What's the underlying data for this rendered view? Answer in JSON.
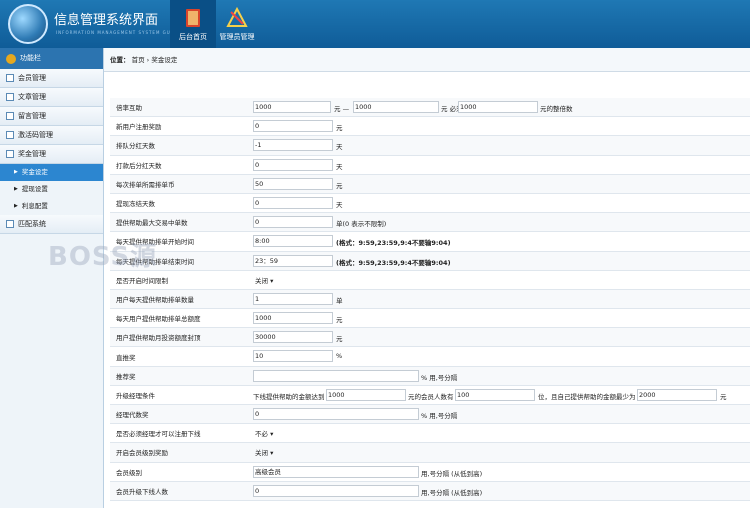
{
  "header": {
    "title": "信息管理系统界面",
    "subtitle": "INFORMATION MANAGEMENT SYSTEM GUI",
    "nav": [
      {
        "label": "后台首页",
        "icon": "book-icon"
      },
      {
        "label": "管理员管理",
        "icon": "tools-icon"
      }
    ]
  },
  "sidebar": {
    "head": "功能栏",
    "items": [
      "会员管理",
      "文章管理",
      "留言管理",
      "激活码管理",
      "奖金管理"
    ],
    "subitems": [
      "奖金设定",
      "提现设置",
      "利息配置"
    ],
    "last": "匹配系统"
  },
  "breadcrumb": {
    "label": "位置：",
    "home": "首页",
    "sep": "›",
    "current": "奖金设定"
  },
  "form": {
    "r1": {
      "label": "倍率互助",
      "v1": "1000",
      "t1": "元 —",
      "v2": "1000",
      "t2": "元 必须",
      "v3": "1000",
      "t3": "元的整倍数"
    },
    "r2": {
      "label": "新用户注册奖励",
      "v": "0",
      "t": "元"
    },
    "r3": {
      "label": "排队分红天数",
      "v": "-1",
      "t": "天"
    },
    "r4": {
      "label": "打款后分红天数",
      "v": "0",
      "t": "天"
    },
    "r5": {
      "label": "每次排单所需排单币",
      "v": "50",
      "t": "元"
    },
    "r6": {
      "label": "提现冻结天数",
      "v": "0",
      "t": "天"
    },
    "r7": {
      "label": "提供帮助最大交易中单数",
      "v": "0",
      "t": "单(0 表示不限制)"
    },
    "r8": {
      "label": "每天提供帮助排单开始时间",
      "v": "8:00",
      "t": "(格式：9:59,23:59,9:4不要输9:04)"
    },
    "r9": {
      "label": "每天提供帮助排单结束时间",
      "v": "23：59",
      "t": "(格式：9:59,23:59,9:4不要输9:04)"
    },
    "r10": {
      "label": "是否开启时间限制",
      "sel": "关闭 ▾"
    },
    "r11": {
      "label": "用户每天提供帮助排单数量",
      "v": "1",
      "t": "单"
    },
    "r12": {
      "label": "每天用户提供帮助排单总额度",
      "v": "1000",
      "t": "元"
    },
    "r13": {
      "label": "用户提供帮助月投资额度封顶",
      "v": "30000",
      "t": "元"
    },
    "r14": {
      "label": "直推奖",
      "v": "10",
      "t": "%"
    },
    "r15": {
      "label": "推荐奖",
      "v": "",
      "t": "% 用,号分隔"
    },
    "r16": {
      "label": "升级经理条件",
      "t1": "下线提供帮助的金额达到",
      "v1": "1000",
      "t2": "元的会员人数有",
      "v2": "100",
      "t3": "位，且自己提供帮助的金额最少为",
      "v3": "2000",
      "t4": "元"
    },
    "r17": {
      "label": "经理代数奖",
      "v": "0",
      "t": "% 用,号分隔"
    },
    "r18": {
      "label": "是否必须经理才可以注册下线",
      "sel": "不必 ▾"
    },
    "r19": {
      "label": "开启会员级别奖励",
      "sel": "关闭 ▾"
    },
    "r20": {
      "label": "会员级别",
      "v": "高级会员",
      "t": "用,号分隔 (从低到高)"
    },
    "r21": {
      "label": "会员升级下线人数",
      "v": "0",
      "t": "用,号分隔 (从低到高)"
    }
  },
  "watermark": "BOSS源",
  "colors": {
    "header": "#1a6aa8",
    "sidebar_active": "#2c86d0",
    "sidebar_head": "#2c74b0"
  }
}
